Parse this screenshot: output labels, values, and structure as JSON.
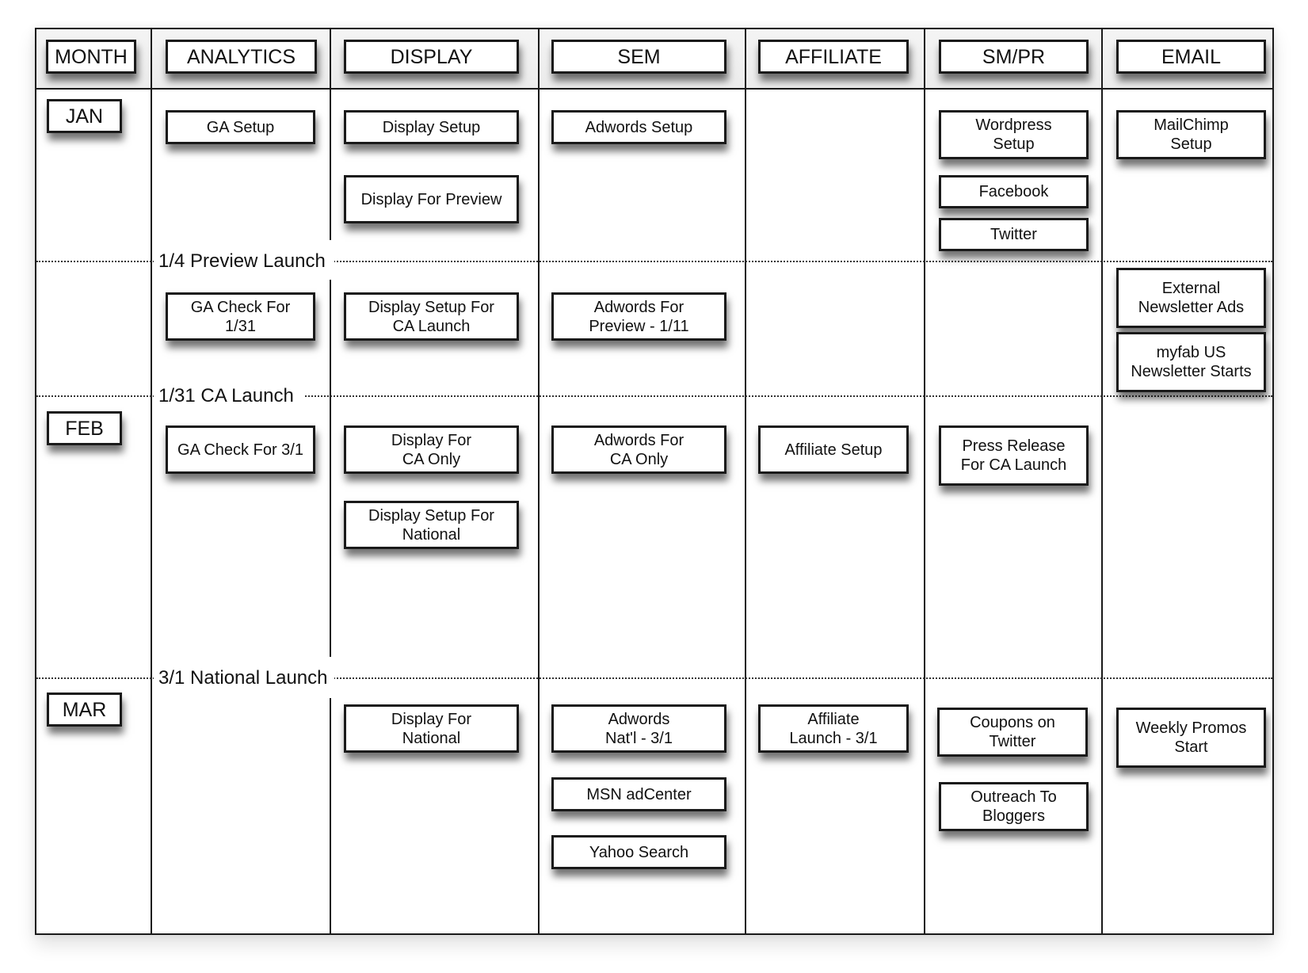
{
  "headers": {
    "month": "MONTH",
    "analytics": "ANALYTICS",
    "display": "DISPLAY",
    "sem": "SEM",
    "affiliate": "AFFILIATE",
    "smpr": "SM/PR",
    "email": "EMAIL"
  },
  "months": {
    "jan": "JAN",
    "feb": "FEB",
    "mar": "MAR"
  },
  "milestones": {
    "preview": "1/4 Preview Launch",
    "ca": "1/31 CA Launch",
    "national": "3/1 National Launch"
  },
  "tasks": {
    "analytics": [
      "GA Setup",
      "GA Check For\n1/31",
      "GA Check For 3/1"
    ],
    "display": [
      "Display Setup",
      "Display For Preview",
      "Display Setup For\nCA Launch",
      "Display For\nCA Only",
      "Display Setup For\nNational",
      "Display For\nNational"
    ],
    "sem": [
      "Adwords Setup",
      "Adwords For\nPreview - 1/11",
      "Adwords For\nCA Only",
      "Adwords\nNat'l - 3/1",
      "MSN adCenter",
      "Yahoo Search"
    ],
    "affiliate": [
      "Affiliate Setup",
      "Affiliate\nLaunch - 3/1"
    ],
    "smpr": [
      "Wordpress\nSetup",
      "Facebook",
      "Twitter",
      "Press Release\nFor CA Launch",
      "Coupons on\nTwitter",
      "Outreach To\nBloggers"
    ],
    "email": [
      "MailChimp\nSetup",
      "External\nNewsletter Ads",
      "myfab US\nNewsletter Starts",
      "Weekly Promos\nStart"
    ]
  }
}
